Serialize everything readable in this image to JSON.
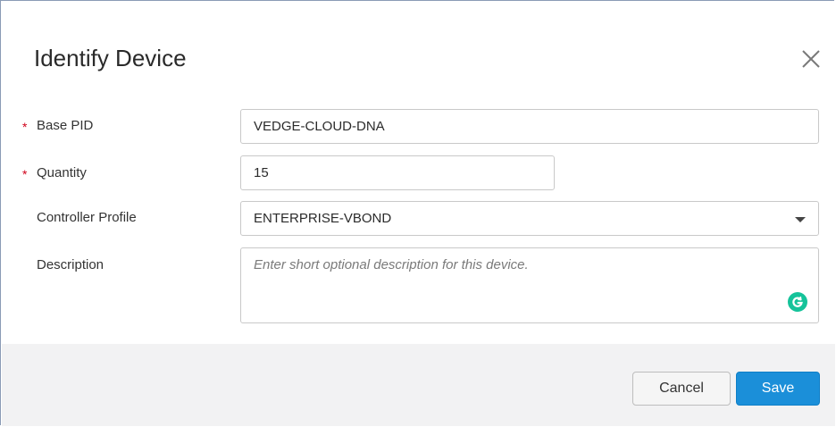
{
  "dialog": {
    "title": "Identify Device",
    "close_icon": "close-icon"
  },
  "form": {
    "required_marker": "*",
    "base_pid": {
      "label": "Base PID",
      "required": true,
      "value": "VEDGE-CLOUD-DNA"
    },
    "quantity": {
      "label": "Quantity",
      "required": true,
      "value": "15"
    },
    "controller_profile": {
      "label": "Controller Profile",
      "required": false,
      "selected": "ENTERPRISE-VBOND",
      "icon": "chevron-down-icon"
    },
    "description": {
      "label": "Description",
      "required": false,
      "value": "",
      "placeholder": "Enter short optional description for this device.",
      "extension_icon": "grammarly-icon"
    }
  },
  "footer": {
    "cancel_label": "Cancel",
    "save_label": "Save"
  },
  "colors": {
    "primary": "#1b8fd9",
    "required": "#d0021b",
    "footer_bg": "#f2f2f3",
    "grammarly": "#15c39a"
  }
}
